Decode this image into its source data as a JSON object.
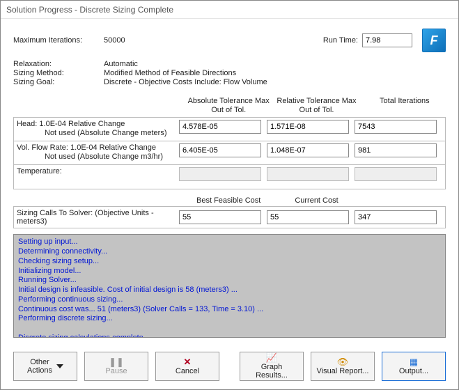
{
  "window": {
    "title": "Solution Progress - Discrete Sizing Complete"
  },
  "top": {
    "max_iterations_label": "Maximum Iterations:",
    "max_iterations_value": "50000",
    "run_time_label": "Run Time:",
    "run_time_value": "7.98"
  },
  "info": {
    "relaxation_k": "Relaxation:",
    "relaxation_v": "Automatic",
    "method_k": "Sizing Method:",
    "method_v": "Modified Method of Feasible Directions",
    "goal_k": "Sizing Goal:",
    "goal_v": "Discrete - Objective Costs Include: Flow Volume"
  },
  "tol_header": {
    "abs": "Absolute Tolerance\nMax Out of Tol.",
    "rel": "Relative Tolerance\nMax Out of Tol.",
    "tot": "Total Iterations"
  },
  "tol_rows": [
    {
      "desc_main": "Head: 1.0E-04 Relative Change",
      "desc_sub": "Not used (Absolute Change meters)",
      "abs": "4.578E-05",
      "rel": "1.571E-08",
      "tot": "7543"
    },
    {
      "desc_main": "Vol. Flow Rate: 1.0E-04 Relative Change",
      "desc_sub": "Not used (Absolute Change m3/hr)",
      "abs": "6.405E-05",
      "rel": "1.048E-07",
      "tot": "981"
    },
    {
      "desc_main": "Temperature:",
      "desc_sub": "",
      "abs": "",
      "rel": "",
      "tot": ""
    }
  ],
  "cost_header": {
    "best": "Best Feasible Cost",
    "current": "Current Cost",
    "blank": ""
  },
  "cost_row": {
    "desc": "Sizing Calls To Solver: (Objective Units - meters3)",
    "best": "55",
    "current": "55",
    "last": "347"
  },
  "log": "Setting up input...\nDetermining connectivity...\nChecking sizing setup...\nInitializing model...\nRunning Solver...\nInitial design is infeasible. Cost of initial design is 58 (meters3) ...\nPerforming continuous sizing...\nContinuous cost was... 51 (meters3)  (Solver Calls = 133, Time = 3.10) ...\nPerforming discrete sizing...\n\nDiscrete sizing calculations complete.",
  "buttons": {
    "other": "Other\nActions",
    "pause": "Pause",
    "cancel": "Cancel",
    "graph": "Graph Results...",
    "visual": "Visual Report...",
    "output": "Output..."
  }
}
